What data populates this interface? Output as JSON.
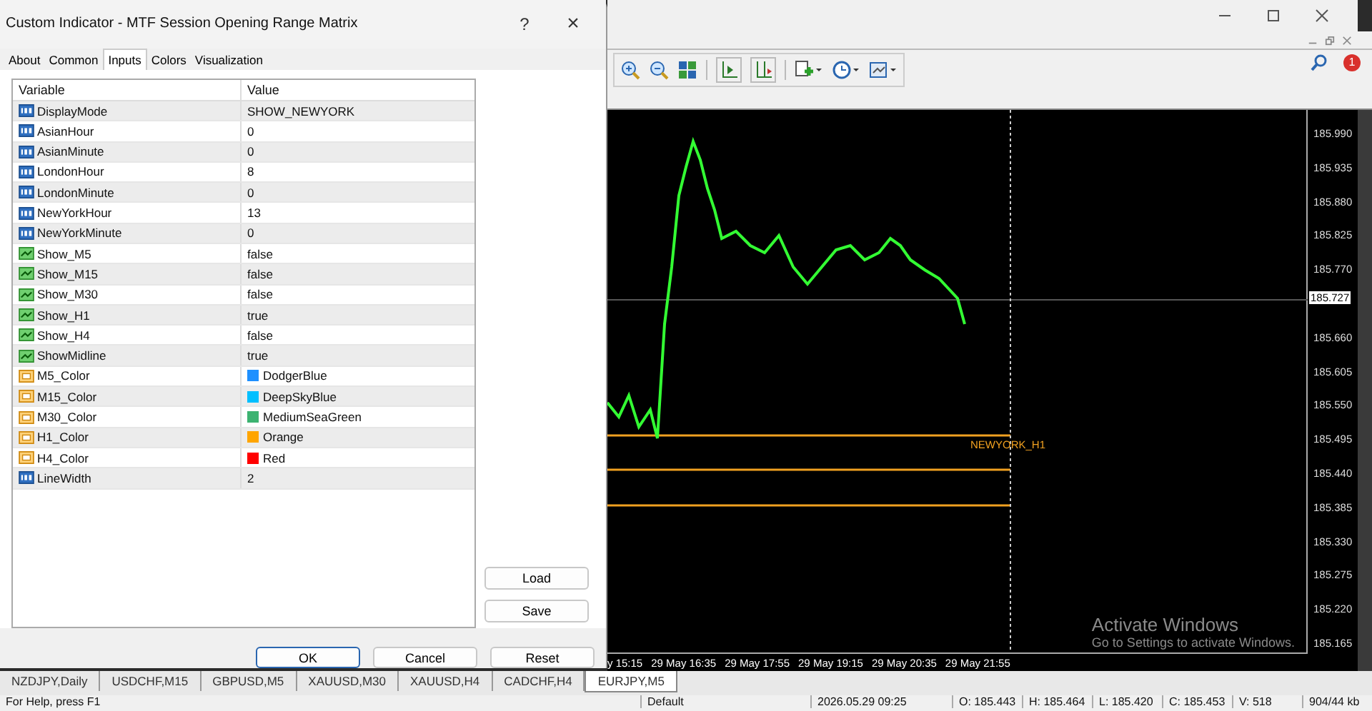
{
  "dialog": {
    "title": "Custom Indicator - MTF Session Opening Range Matrix",
    "help": "?",
    "close": "×",
    "tabs": [
      {
        "label": "About",
        "selected": false
      },
      {
        "label": "Common",
        "selected": false
      },
      {
        "label": "Inputs",
        "selected": true
      },
      {
        "label": "Colors",
        "selected": false
      },
      {
        "label": "Visualization",
        "selected": false
      }
    ],
    "table": {
      "columns": [
        "Variable",
        "Value"
      ],
      "rows": [
        {
          "kind": "int",
          "variable": "DisplayMode",
          "value": "SHOW_NEWYORK"
        },
        {
          "kind": "int",
          "variable": "AsianHour",
          "value": "0"
        },
        {
          "kind": "int",
          "variable": "AsianMinute",
          "value": "0"
        },
        {
          "kind": "int",
          "variable": "LondonHour",
          "value": "8"
        },
        {
          "kind": "int",
          "variable": "LondonMinute",
          "value": "0"
        },
        {
          "kind": "int",
          "variable": "NewYorkHour",
          "value": "13"
        },
        {
          "kind": "int",
          "variable": "NewYorkMinute",
          "value": "0"
        },
        {
          "kind": "bool",
          "variable": "Show_M5",
          "value": "false"
        },
        {
          "kind": "bool",
          "variable": "Show_M15",
          "value": "false"
        },
        {
          "kind": "bool",
          "variable": "Show_M30",
          "value": "false"
        },
        {
          "kind": "bool",
          "variable": "Show_H1",
          "value": "true"
        },
        {
          "kind": "bool",
          "variable": "Show_H4",
          "value": "false"
        },
        {
          "kind": "bool",
          "variable": "ShowMidline",
          "value": "true"
        },
        {
          "kind": "color",
          "variable": "M5_Color",
          "value": "DodgerBlue",
          "color": "#1e90ff"
        },
        {
          "kind": "color",
          "variable": "M15_Color",
          "value": "DeepSkyBlue",
          "color": "#00bfff"
        },
        {
          "kind": "color",
          "variable": "M30_Color",
          "value": "MediumSeaGreen",
          "color": "#3cb371"
        },
        {
          "kind": "color",
          "variable": "H1_Color",
          "value": "Orange",
          "color": "#ffa500"
        },
        {
          "kind": "color",
          "variable": "H4_Color",
          "value": "Red",
          "color": "#ff0000"
        },
        {
          "kind": "int",
          "variable": "LineWidth",
          "value": "2"
        }
      ]
    },
    "side_buttons": [
      "Load",
      "Save"
    ],
    "buttons": [
      "OK",
      "Cancel",
      "Reset"
    ]
  },
  "terminal": {
    "notification_count": "1"
  },
  "chart": {
    "price_labels": [
      "185.990",
      "185.935",
      "185.880",
      "185.825",
      "185.770",
      "185.660",
      "185.605",
      "185.550",
      "185.495",
      "185.440",
      "185.385",
      "185.330",
      "185.275",
      "185.220",
      "185.165"
    ],
    "current_price": "185.727",
    "line_label": "NEWYORK_H1",
    "time_labels": [
      "y 15:15",
      "29 May 16:35",
      "29 May 17:55",
      "29 May 19:15",
      "29 May 20:35",
      "29 May 21:55"
    ],
    "activation_notice": {
      "title": "Activate Windows",
      "text": "Go to Settings to activate Windows."
    }
  },
  "chart_tabs": [
    {
      "label": "NZDJPY,Daily",
      "selected": false
    },
    {
      "label": "USDCHF,M15",
      "selected": false
    },
    {
      "label": "GBPUSD,M5",
      "selected": false
    },
    {
      "label": "XAUUSD,M30",
      "selected": false
    },
    {
      "label": "XAUUSD,H4",
      "selected": false
    },
    {
      "label": "CADCHF,H4",
      "selected": false
    },
    {
      "label": "EURJPY,M5",
      "selected": true
    }
  ],
  "status_bar": [
    "For Help, press F1",
    "Default",
    "2026.05.29 09:25",
    "O: 185.443",
    "H: 185.464",
    "L: 185.420",
    "C: 185.453",
    "V: 518",
    "904/44 kb"
  ]
}
